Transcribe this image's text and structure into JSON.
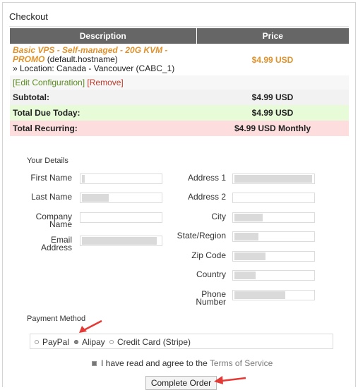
{
  "title": "Checkout",
  "cart": {
    "headers": {
      "description": "Description",
      "price": "Price"
    },
    "product": {
      "name": "Basic VPS - Self-managed - 20G KVM - PROMO",
      "hostname": "(default.hostname)",
      "location": "» Location: Canada - Vancouver (CABC_1)",
      "price": "$4.99 USD"
    },
    "actions": {
      "edit": "[Edit Configuration]",
      "remove": "[Remove]"
    },
    "subtotal": {
      "label": "Subtotal:",
      "value": "$4.99 USD"
    },
    "due_today": {
      "label": "Total Due Today:",
      "value": "$4.99 USD"
    },
    "recurring": {
      "label": "Total Recurring:",
      "value": "$4.99 USD Monthly"
    },
    "colors": {
      "header_bg": "#666666",
      "product": "#e0922a",
      "due_bg": "#e8fbd9",
      "recurring_bg": "#fddddd"
    }
  },
  "details": {
    "heading": "Your Details",
    "left_fields": [
      "First Name",
      "Last Name",
      "Company Name",
      "Email Address"
    ],
    "right_fields": [
      "Address 1",
      "Address 2",
      "City",
      "State/Region",
      "Zip Code",
      "Country",
      "Phone Number"
    ]
  },
  "payment": {
    "heading": "Payment Method",
    "options": [
      "PayPal",
      "Alipay",
      "Credit Card (Stripe)"
    ],
    "selected": "Alipay"
  },
  "tos": {
    "text": "I have read and agree to the",
    "link": "Terms of Service",
    "checked": true
  },
  "submit": {
    "label": "Complete Order"
  },
  "annotations": {
    "arrow_color": "#e53935"
  }
}
